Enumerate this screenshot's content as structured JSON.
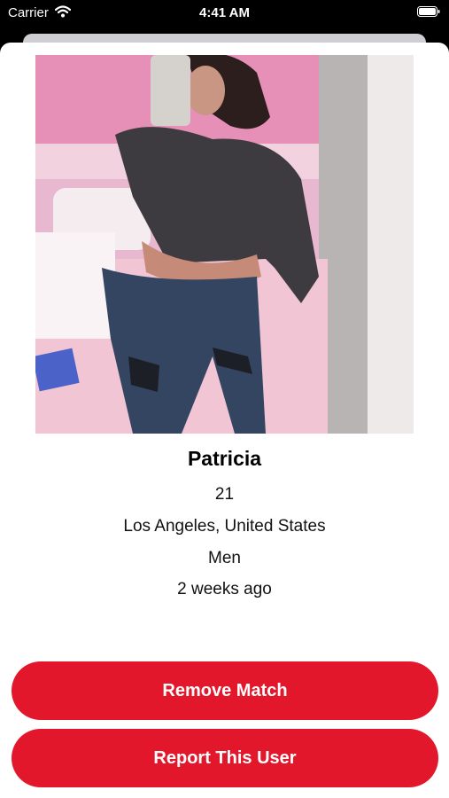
{
  "status_bar": {
    "carrier": "Carrier",
    "time": "4:41 AM"
  },
  "profile": {
    "name": "Patricia",
    "age": "21",
    "location": "Los Angeles, United States",
    "interested_in": "Men",
    "last_seen": "2 weeks ago"
  },
  "actions": {
    "remove_match": "Remove Match",
    "report_user": "Report This User"
  },
  "colors": {
    "accent": "#e3172b"
  }
}
